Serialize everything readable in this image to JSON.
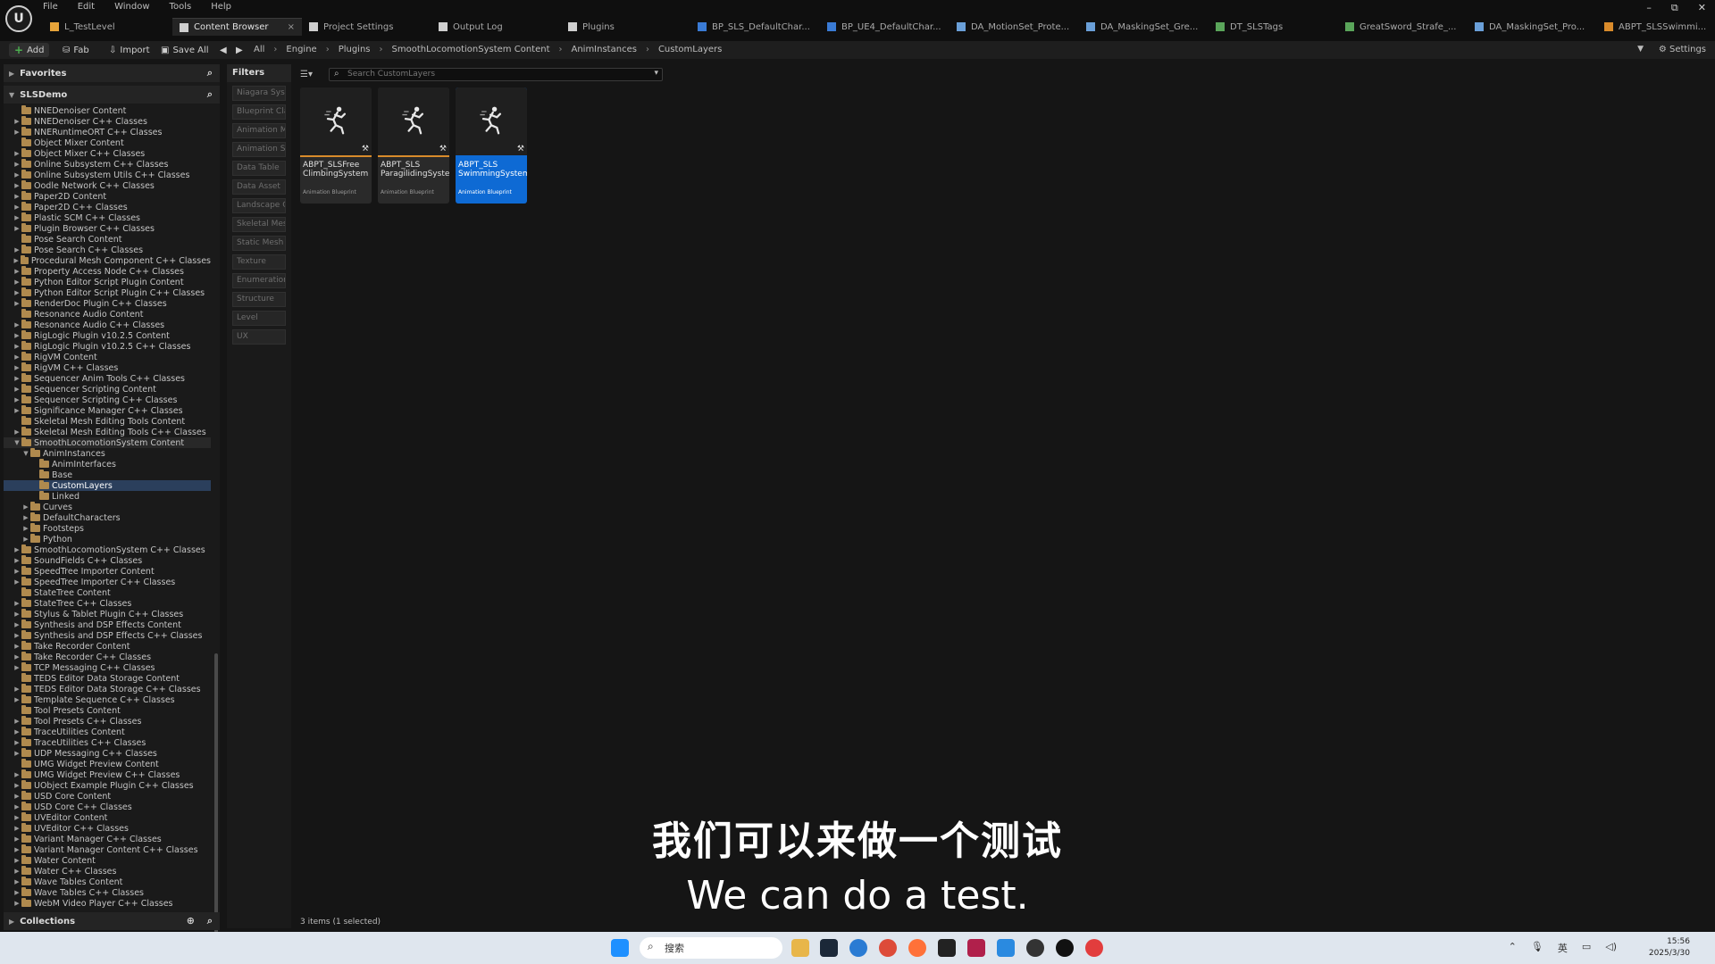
{
  "menu": [
    "File",
    "Edit",
    "Window",
    "Tools",
    "Help"
  ],
  "tabs": [
    {
      "label": "L_TestLevel",
      "icon": "level-icon",
      "color": "#e6a43a"
    },
    {
      "label": "Content Browser",
      "icon": "content-browser-icon",
      "color": "#cfcfcf",
      "close": "×"
    },
    {
      "label": "Project Settings",
      "icon": "gear-icon",
      "color": "#cfcfcf"
    },
    {
      "label": "Output Log",
      "icon": "log-icon",
      "color": "#cfcfcf"
    },
    {
      "label": "Plugins",
      "icon": "plugin-icon",
      "color": "#cfcfcf"
    },
    {
      "label": "BP_SLS_DefaultChar...",
      "icon": "blueprint-icon",
      "color": "#3a7bd5"
    },
    {
      "label": "BP_UE4_DefaultChar...",
      "icon": "blueprint-icon",
      "color": "#3a7bd5"
    },
    {
      "label": "DA_MotionSet_Prote...",
      "icon": "data-asset-icon",
      "color": "#6a9fd8"
    },
    {
      "label": "DA_MaskingSet_Gre...",
      "icon": "data-asset-icon",
      "color": "#6a9fd8"
    },
    {
      "label": "DT_SLSTags",
      "icon": "data-table-icon",
      "color": "#5aa55a"
    },
    {
      "label": "GreatSword_Strafe_...",
      "icon": "animation-icon",
      "color": "#5aa55a"
    },
    {
      "label": "DA_MaskingSet_Pro...",
      "icon": "data-asset-icon",
      "color": "#6a9fd8"
    },
    {
      "label": "ABPT_SLSSwimmi...",
      "icon": "anim-blueprint-icon",
      "color": "#d98b2b"
    }
  ],
  "toolbar": {
    "add": "Add",
    "fab": "Fab",
    "import": "Import",
    "save_all": "Save All",
    "settings": "Settings"
  },
  "breadcrumb": [
    "All",
    "Engine",
    "Plugins",
    "SmoothLocomotionSystem Content",
    "AnimInstances",
    "CustomLayers"
  ],
  "panels": {
    "favorites": "Favorites",
    "project": "SLSDemo",
    "collections": "Collections",
    "filters": "Filters"
  },
  "tree": [
    {
      "label": "NNEDenoiser Content",
      "indent": 1,
      "exp": ""
    },
    {
      "label": "NNEDenoiser C++ Classes",
      "indent": 1,
      "exp": "▶"
    },
    {
      "label": "NNERuntimeORT C++ Classes",
      "indent": 1,
      "exp": "▶"
    },
    {
      "label": "Object Mixer Content",
      "indent": 1,
      "exp": ""
    },
    {
      "label": "Object Mixer C++ Classes",
      "indent": 1,
      "exp": "▶"
    },
    {
      "label": "Online Subsystem C++ Classes",
      "indent": 1,
      "exp": "▶"
    },
    {
      "label": "Online Subsystem Utils C++ Classes",
      "indent": 1,
      "exp": "▶"
    },
    {
      "label": "Oodle Network C++ Classes",
      "indent": 1,
      "exp": "▶"
    },
    {
      "label": "Paper2D Content",
      "indent": 1,
      "exp": "▶"
    },
    {
      "label": "Paper2D C++ Classes",
      "indent": 1,
      "exp": "▶"
    },
    {
      "label": "Plastic SCM C++ Classes",
      "indent": 1,
      "exp": "▶"
    },
    {
      "label": "Plugin Browser C++ Classes",
      "indent": 1,
      "exp": "▶"
    },
    {
      "label": "Pose Search Content",
      "indent": 1,
      "exp": ""
    },
    {
      "label": "Pose Search C++ Classes",
      "indent": 1,
      "exp": "▶"
    },
    {
      "label": "Procedural Mesh Component C++ Classes",
      "indent": 1,
      "exp": "▶"
    },
    {
      "label": "Property Access Node C++ Classes",
      "indent": 1,
      "exp": "▶"
    },
    {
      "label": "Python Editor Script Plugin Content",
      "indent": 1,
      "exp": "▶"
    },
    {
      "label": "Python Editor Script Plugin C++ Classes",
      "indent": 1,
      "exp": "▶"
    },
    {
      "label": "RenderDoc Plugin C++ Classes",
      "indent": 1,
      "exp": "▶"
    },
    {
      "label": "Resonance Audio Content",
      "indent": 1,
      "exp": ""
    },
    {
      "label": "Resonance Audio C++ Classes",
      "indent": 1,
      "exp": "▶"
    },
    {
      "label": "RigLogic Plugin v10.2.5 Content",
      "indent": 1,
      "exp": "▶"
    },
    {
      "label": "RigLogic Plugin v10.2.5 C++ Classes",
      "indent": 1,
      "exp": "▶"
    },
    {
      "label": "RigVM Content",
      "indent": 1,
      "exp": "▶"
    },
    {
      "label": "RigVM C++ Classes",
      "indent": 1,
      "exp": "▶"
    },
    {
      "label": "Sequencer Anim Tools C++ Classes",
      "indent": 1,
      "exp": "▶"
    },
    {
      "label": "Sequencer Scripting Content",
      "indent": 1,
      "exp": "▶"
    },
    {
      "label": "Sequencer Scripting C++ Classes",
      "indent": 1,
      "exp": "▶"
    },
    {
      "label": "Significance Manager C++ Classes",
      "indent": 1,
      "exp": "▶"
    },
    {
      "label": "Skeletal Mesh Editing Tools Content",
      "indent": 1,
      "exp": ""
    },
    {
      "label": "Skeletal Mesh Editing Tools C++ Classes",
      "indent": 1,
      "exp": "▶"
    },
    {
      "label": "SmoothLocomotionSystem Content",
      "indent": 1,
      "exp": "▼",
      "state": "hl"
    },
    {
      "label": "AnimInstances",
      "indent": 2,
      "exp": "▼"
    },
    {
      "label": "AnimInterfaces",
      "indent": 3,
      "exp": ""
    },
    {
      "label": "Base",
      "indent": 3,
      "exp": ""
    },
    {
      "label": "CustomLayers",
      "indent": 3,
      "exp": "",
      "state": "sel"
    },
    {
      "label": "Linked",
      "indent": 3,
      "exp": ""
    },
    {
      "label": "Curves",
      "indent": 2,
      "exp": "▶"
    },
    {
      "label": "DefaultCharacters",
      "indent": 2,
      "exp": "▶"
    },
    {
      "label": "Footsteps",
      "indent": 2,
      "exp": "▶"
    },
    {
      "label": "Python",
      "indent": 2,
      "exp": "▶"
    },
    {
      "label": "SmoothLocomotionSystem C++ Classes",
      "indent": 1,
      "exp": "▶"
    },
    {
      "label": "SoundFields C++ Classes",
      "indent": 1,
      "exp": "▶"
    },
    {
      "label": "SpeedTree Importer Content",
      "indent": 1,
      "exp": "▶"
    },
    {
      "label": "SpeedTree Importer C++ Classes",
      "indent": 1,
      "exp": "▶"
    },
    {
      "label": "StateTree Content",
      "indent": 1,
      "exp": ""
    },
    {
      "label": "StateTree C++ Classes",
      "indent": 1,
      "exp": "▶"
    },
    {
      "label": "Stylus & Tablet Plugin C++ Classes",
      "indent": 1,
      "exp": "▶"
    },
    {
      "label": "Synthesis and DSP Effects Content",
      "indent": 1,
      "exp": "▶"
    },
    {
      "label": "Synthesis and DSP Effects C++ Classes",
      "indent": 1,
      "exp": "▶"
    },
    {
      "label": "Take Recorder Content",
      "indent": 1,
      "exp": "▶"
    },
    {
      "label": "Take Recorder C++ Classes",
      "indent": 1,
      "exp": "▶"
    },
    {
      "label": "TCP Messaging C++ Classes",
      "indent": 1,
      "exp": "▶"
    },
    {
      "label": "TEDS Editor Data Storage Content",
      "indent": 1,
      "exp": ""
    },
    {
      "label": "TEDS Editor Data Storage C++ Classes",
      "indent": 1,
      "exp": "▶"
    },
    {
      "label": "Template Sequence C++ Classes",
      "indent": 1,
      "exp": "▶"
    },
    {
      "label": "Tool Presets Content",
      "indent": 1,
      "exp": ""
    },
    {
      "label": "Tool Presets C++ Classes",
      "indent": 1,
      "exp": "▶"
    },
    {
      "label": "TraceUtilities Content",
      "indent": 1,
      "exp": "▶"
    },
    {
      "label": "TraceUtilities C++ Classes",
      "indent": 1,
      "exp": "▶"
    },
    {
      "label": "UDP Messaging C++ Classes",
      "indent": 1,
      "exp": "▶"
    },
    {
      "label": "UMG Widget Preview Content",
      "indent": 1,
      "exp": ""
    },
    {
      "label": "UMG Widget Preview C++ Classes",
      "indent": 1,
      "exp": "▶"
    },
    {
      "label": "UObject Example Plugin C++ Classes",
      "indent": 1,
      "exp": "▶"
    },
    {
      "label": "USD Core Content",
      "indent": 1,
      "exp": "▶"
    },
    {
      "label": "USD Core C++ Classes",
      "indent": 1,
      "exp": "▶"
    },
    {
      "label": "UVEditor Content",
      "indent": 1,
      "exp": "▶"
    },
    {
      "label": "UVEditor C++ Classes",
      "indent": 1,
      "exp": "▶"
    },
    {
      "label": "Variant Manager C++ Classes",
      "indent": 1,
      "exp": "▶"
    },
    {
      "label": "Variant Manager Content C++ Classes",
      "indent": 1,
      "exp": "▶"
    },
    {
      "label": "Water Content",
      "indent": 1,
      "exp": "▶"
    },
    {
      "label": "Water C++ Classes",
      "indent": 1,
      "exp": "▶"
    },
    {
      "label": "Wave Tables Content",
      "indent": 1,
      "exp": "▶"
    },
    {
      "label": "Wave Tables C++ Classes",
      "indent": 1,
      "exp": "▶"
    },
    {
      "label": "WebM Video Player C++ Classes",
      "indent": 1,
      "exp": "▶"
    }
  ],
  "filters": [
    "Niagara Syst",
    "Blueprint Cla",
    "Animation M",
    "Animation Se",
    "Data Table",
    "Data Asset",
    "Landscape G",
    "Skeletal Mes",
    "Static Mesh",
    "Texture",
    "Enumeration",
    "Structure",
    "Level",
    "UX"
  ],
  "search": {
    "placeholder": "Search CustomLayers"
  },
  "assets": [
    {
      "name": "ABPT_SLSFree ClimbingSystem",
      "type": "Animation Blueprint",
      "selected": false
    },
    {
      "name": "ABPT_SLS ParagilidingSystem",
      "type": "Animation Blueprint",
      "selected": false
    },
    {
      "name": "ABPT_SLS SwimmingSystem",
      "type": "Animation Blueprint",
      "selected": true
    }
  ],
  "status": {
    "item_count": "3 items (1 selected)"
  },
  "subtitles": {
    "zh": "我们可以来做一个测试",
    "en": "We can do a test."
  },
  "taskbar": {
    "search_label": "搜索",
    "time": "15:56",
    "date": "2025/3/30"
  },
  "window_controls": [
    "–",
    "⧉",
    "✕"
  ]
}
